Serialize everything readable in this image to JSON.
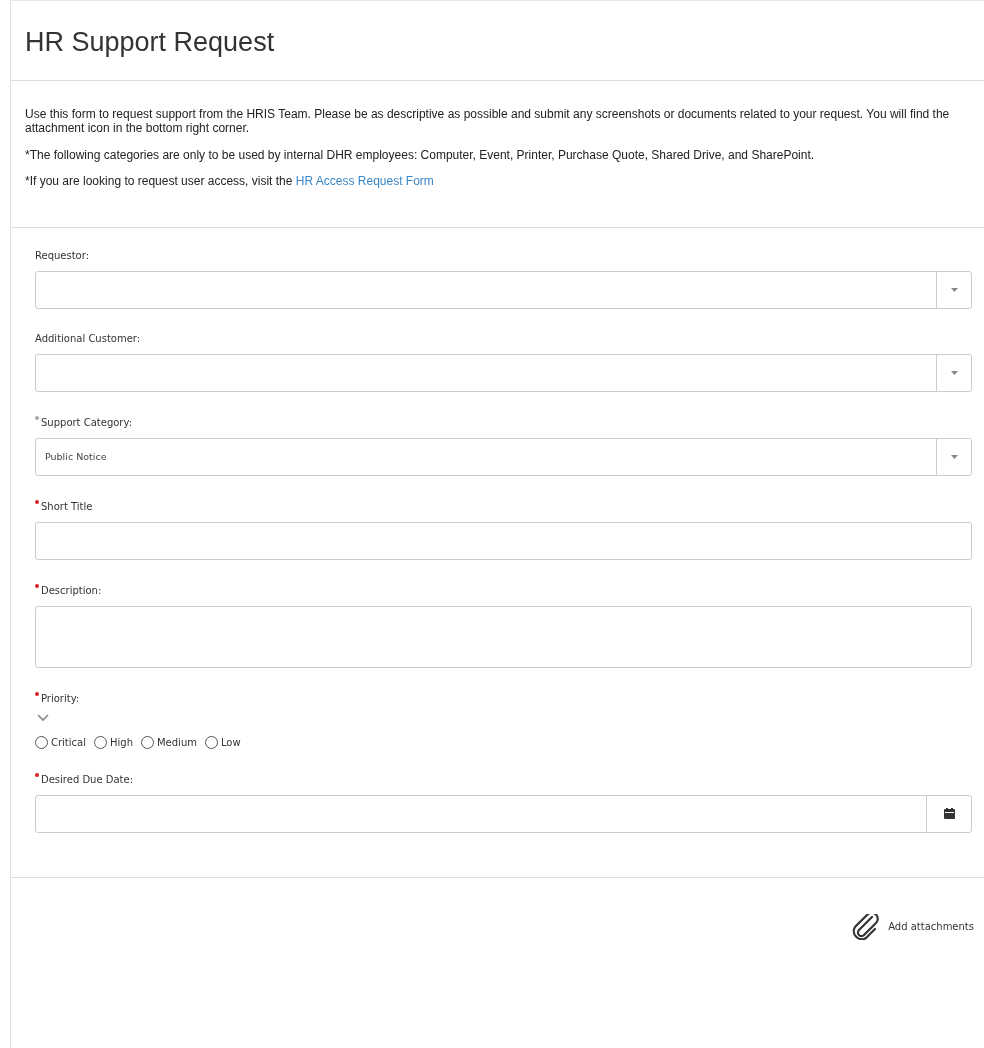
{
  "title": "HR Support Request",
  "intro": [
    "Use this form to request support from the HRIS Team. Please be as descriptive as possible and submit any screenshots or documents related to your request. You will find the attachment icon in the bottom right corner.",
    "*The following categories are only to be used by internal DHR employees: Computer, Event, Printer, Purchase Quote, Shared Drive, and SharePoint."
  ],
  "access_note": {
    "text": "*If you are looking to request user access, visit the",
    "link": "HR Access Request Form"
  },
  "fields": [
    {
      "kind": "select",
      "label": "Requestor:",
      "required": false
    },
    {
      "kind": "select",
      "label": "Additional Customer:",
      "required": false
    },
    {
      "kind": "select",
      "label": "Support Category:",
      "required": true,
      "value": "Public Notice"
    },
    {
      "kind": "text",
      "label": "Short Title",
      "required": true
    },
    {
      "kind": "textarea",
      "label": "Description:",
      "required": true
    },
    {
      "kind": "radio",
      "label": "Priority:",
      "required": true,
      "options": [
        {
          "label": "Critical",
          "selected": false
        },
        {
          "label": "High",
          "selected": false
        },
        {
          "label": "Medium",
          "selected": false
        },
        {
          "label": "Low",
          "selected": false
        }
      ]
    },
    {
      "kind": "date",
      "label": "Desired Due Date:",
      "required": true
    }
  ],
  "attach": "Add attachments"
}
